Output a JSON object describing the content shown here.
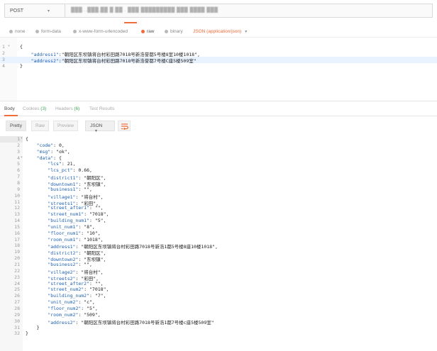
{
  "request": {
    "method": "POST",
    "url": "███...███,██ █ ██ . ███ █████████ ███ ████ ███"
  },
  "body_types": [
    {
      "label": "none",
      "selected": false
    },
    {
      "label": "form-data",
      "selected": false
    },
    {
      "label": "x-www-form-urlencoded",
      "selected": false
    },
    {
      "label": "raw",
      "selected": true
    },
    {
      "label": "binary",
      "selected": false
    }
  ],
  "content_type": "JSON (application/json)",
  "request_body": [
    {
      "n": "1",
      "fold": "▾",
      "text": "{"
    },
    {
      "n": "2",
      "text": "    \"address1\":\"朝阳区东坝镇将台村彩田路7018号新浩誉都5号楼8室10楼1018\","
    },
    {
      "n": "3",
      "text": "    \"address2\":\"朝阳区东坝镇将台村彩田路7018号新浩誉都7号楼C座5楼509室\""
    },
    {
      "n": "4",
      "text": "}"
    }
  ],
  "response_tabs": [
    {
      "label": "Body",
      "count": "",
      "active": true
    },
    {
      "label": "Cookies",
      "count": "(3)",
      "active": false
    },
    {
      "label": "Headers",
      "count": "(6)",
      "active": false
    },
    {
      "label": "Test Results",
      "count": "",
      "active": false
    }
  ],
  "toolbar": {
    "pretty": "Pretty",
    "raw": "Raw",
    "preview": "Preview",
    "format": "JSON"
  },
  "response_body": [
    {
      "n": "1",
      "fold": "▾",
      "text": "{"
    },
    {
      "n": "2",
      "text": "    \"code\": 0,"
    },
    {
      "n": "3",
      "text": "    \"msg\": \"ok\","
    },
    {
      "n": "4",
      "fold": "▾",
      "text": "    \"data\": {"
    },
    {
      "n": "5",
      "text": "        \"lcs\": 21,"
    },
    {
      "n": "6",
      "text": "        \"lcs_pct\": 0.66,"
    },
    {
      "n": "7",
      "text": "        \"district1\": \"朝阳区\","
    },
    {
      "n": "8",
      "text": "        \"downtown1\": \"东坝镇\","
    },
    {
      "n": "9",
      "text": "        \"business1\": \"\","
    },
    {
      "n": "10",
      "text": "        \"village1\": \"将台村\","
    },
    {
      "n": "11",
      "text": "        \"streets1\": \"彩田\","
    },
    {
      "n": "12",
      "text": "        \"street_after1\": \"\","
    },
    {
      "n": "13",
      "text": "        \"street_num1\": \"7018\","
    },
    {
      "n": "14",
      "text": "        \"building_num1\": \"5\","
    },
    {
      "n": "15",
      "text": "        \"unit_num1\": \"8\","
    },
    {
      "n": "16",
      "text": "        \"floor_num1\": \"10\","
    },
    {
      "n": "17",
      "text": "        \"room_num1\": \"1018\","
    },
    {
      "n": "18",
      "text": "        \"address1\": \"朝阳区东坝镇将台村彩田路7018号新浩1都5号楼8座10楼1018\","
    },
    {
      "n": "19",
      "text": "        \"district2\": \"朝阳区\","
    },
    {
      "n": "20",
      "text": "        \"downtown2\": \"东坝镇\","
    },
    {
      "n": "21",
      "text": "        \"business2\": \"\","
    },
    {
      "n": "22",
      "text": "        \"village2\": \"将台村\","
    },
    {
      "n": "23",
      "text": "        \"streets2\": \"彩田\","
    },
    {
      "n": "24",
      "text": "        \"street_after2\": \"\","
    },
    {
      "n": "25",
      "text": "        \"street_num2\": \"7018\","
    },
    {
      "n": "26",
      "text": "        \"building_num2\": \"7\","
    },
    {
      "n": "27",
      "text": "        \"unit_num2\": \"c\","
    },
    {
      "n": "28",
      "text": "        \"floor_num2\": \"5\","
    },
    {
      "n": "29",
      "text": "        \"room_num2\": \"509\","
    },
    {
      "n": "30",
      "text": "        \"address2\": \"朝阳区东坝镇将台村彩田路7018号新浩1都7号楼c座5楼509室\""
    },
    {
      "n": "31",
      "text": "    }"
    },
    {
      "n": "32",
      "text": "}"
    }
  ],
  "colors": {
    "accent": "#f26b3a",
    "count": "#3aa655",
    "json_key": "#1c5fb0"
  }
}
